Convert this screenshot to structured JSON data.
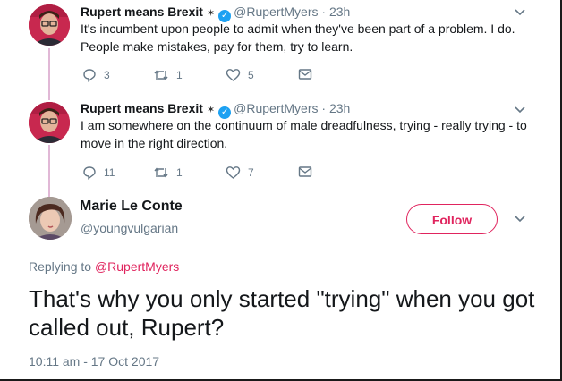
{
  "tweets": [
    {
      "name": "Rupert means Brexit",
      "handle": "@RupertMyers",
      "time": "23h",
      "text": "It's incumbent upon people to admit when they've been part of a problem. I do. People make mistakes, pay for them, try to learn.",
      "replies": "3",
      "retweets": "1",
      "likes": "5"
    },
    {
      "name": "Rupert means Brexit",
      "handle": "@RupertMyers",
      "time": "23h",
      "text": "I am somewhere on the continuum of male dreadfulness, trying - really trying - to move in the right direction.",
      "replies": "11",
      "retweets": "1",
      "likes": "7"
    }
  ],
  "main": {
    "name": "Marie Le Conte",
    "handle": "@youngvulgarian",
    "follow_label": "Follow",
    "replying_prefix": "Replying to",
    "replying_to": "@RupertMyers",
    "text": "That's why you only started \"trying\" when you got called out, Rupert?",
    "timestamp": "10:11 am - 17 Oct 2017"
  },
  "colors": {
    "accent": "#e0245e",
    "verified": "#1da1f2",
    "secondary_text": "#657786"
  },
  "icons": [
    "reply-icon",
    "retweet-icon",
    "like-icon",
    "message-icon",
    "verified-icon",
    "chevron-down-icon"
  ]
}
